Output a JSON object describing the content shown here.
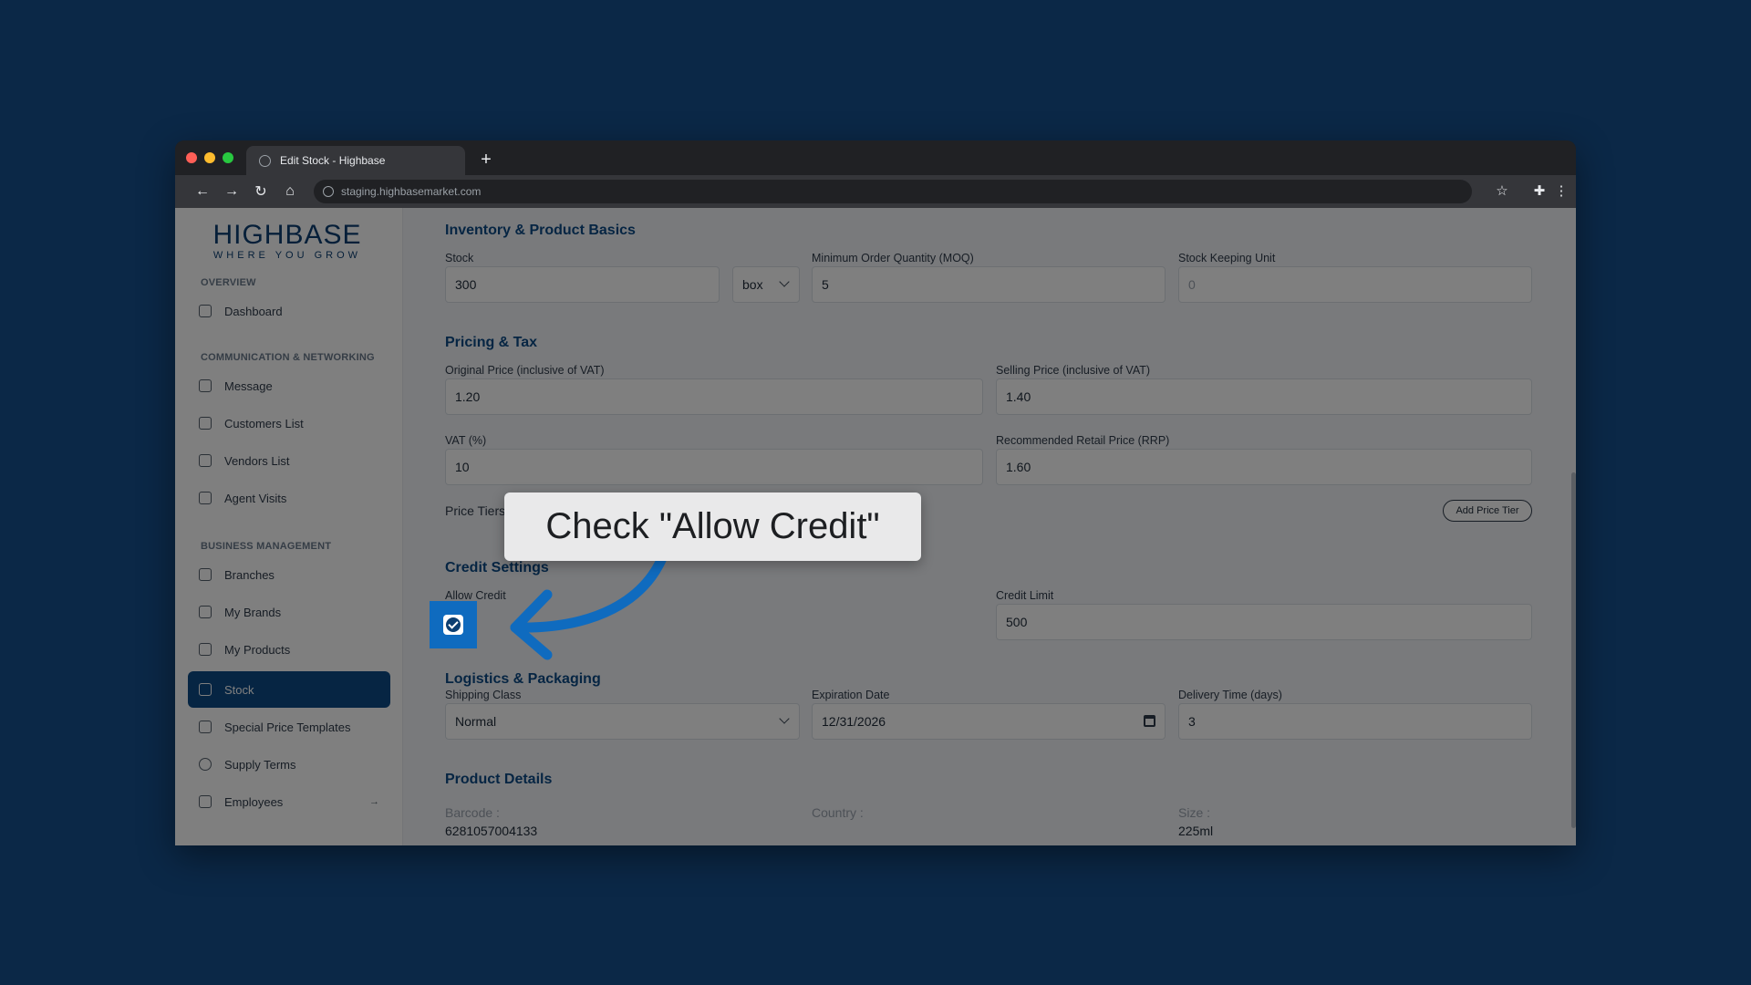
{
  "browser": {
    "tab_title": "Edit Stock - Highbase",
    "url": "staging.highbasemarket.com"
  },
  "sidebar": {
    "logo_brand": "HIGHBASE",
    "logo_tagline": "WHERE YOU GROW",
    "sections": {
      "overview": "OVERVIEW",
      "communication": "COMMUNICATION & NETWORKING",
      "business": "BUSINESS MANAGEMENT"
    },
    "items": [
      {
        "label": "Dashboard",
        "icon": "home-icon"
      },
      {
        "label": "Message",
        "icon": "cube-icon"
      },
      {
        "label": "Customers List",
        "icon": "users-icon"
      },
      {
        "label": "Vendors List",
        "icon": "users-icon"
      },
      {
        "label": "Agent Visits",
        "icon": "truck-icon"
      },
      {
        "label": "Branches",
        "icon": "store-icon"
      },
      {
        "label": "My Brands",
        "icon": "star-icon"
      },
      {
        "label": "My Products",
        "icon": "archive-icon"
      },
      {
        "label": "Stock",
        "icon": "archive-icon",
        "active": true
      },
      {
        "label": "Special Price Templates",
        "icon": "list-icon"
      },
      {
        "label": "Supply Terms",
        "icon": "info-icon"
      },
      {
        "label": "Employees",
        "icon": "users-cog-icon"
      }
    ]
  },
  "form": {
    "inventory": {
      "title": "Inventory & Product Basics",
      "stock_label": "Stock",
      "stock_value": "300",
      "unit_value": "box",
      "moq_label": "Minimum Order Quantity (MOQ)",
      "moq_value": "5",
      "sku_label": "Stock Keeping Unit",
      "sku_placeholder": "0"
    },
    "pricing": {
      "title": "Pricing & Tax",
      "original_label": "Original Price (inclusive of VAT)",
      "original_value": "1.20",
      "selling_label": "Selling Price (inclusive of VAT)",
      "selling_value": "1.40",
      "vat_label": "VAT (%)",
      "vat_value": "10",
      "rrp_label": "Recommended Retail Price (RRP)",
      "rrp_value": "1.60",
      "price_tiers_label": "Price Tiers",
      "add_tier_button": "Add Price Tier"
    },
    "credit": {
      "title": "Credit Settings",
      "allow_credit_label": "Allow Credit",
      "allow_credit_checked": true,
      "credit_limit_label": "Credit Limit",
      "credit_limit_value": "500"
    },
    "logistics": {
      "title": "Logistics & Packaging",
      "shipping_label": "Shipping Class",
      "shipping_value": "Normal",
      "expiration_label": "Expiration Date",
      "expiration_value": "12/31/2026",
      "delivery_label": "Delivery Time (days)",
      "delivery_value": "3"
    },
    "details": {
      "title": "Product Details",
      "barcode_label": "Barcode :",
      "barcode_value": "6281057004133",
      "country_label": "Country :",
      "size_label": "Size :",
      "size_value": "225ml"
    }
  },
  "callout": {
    "text": "Check \"Allow Credit\"",
    "accent_color": "#0f6bbf"
  }
}
